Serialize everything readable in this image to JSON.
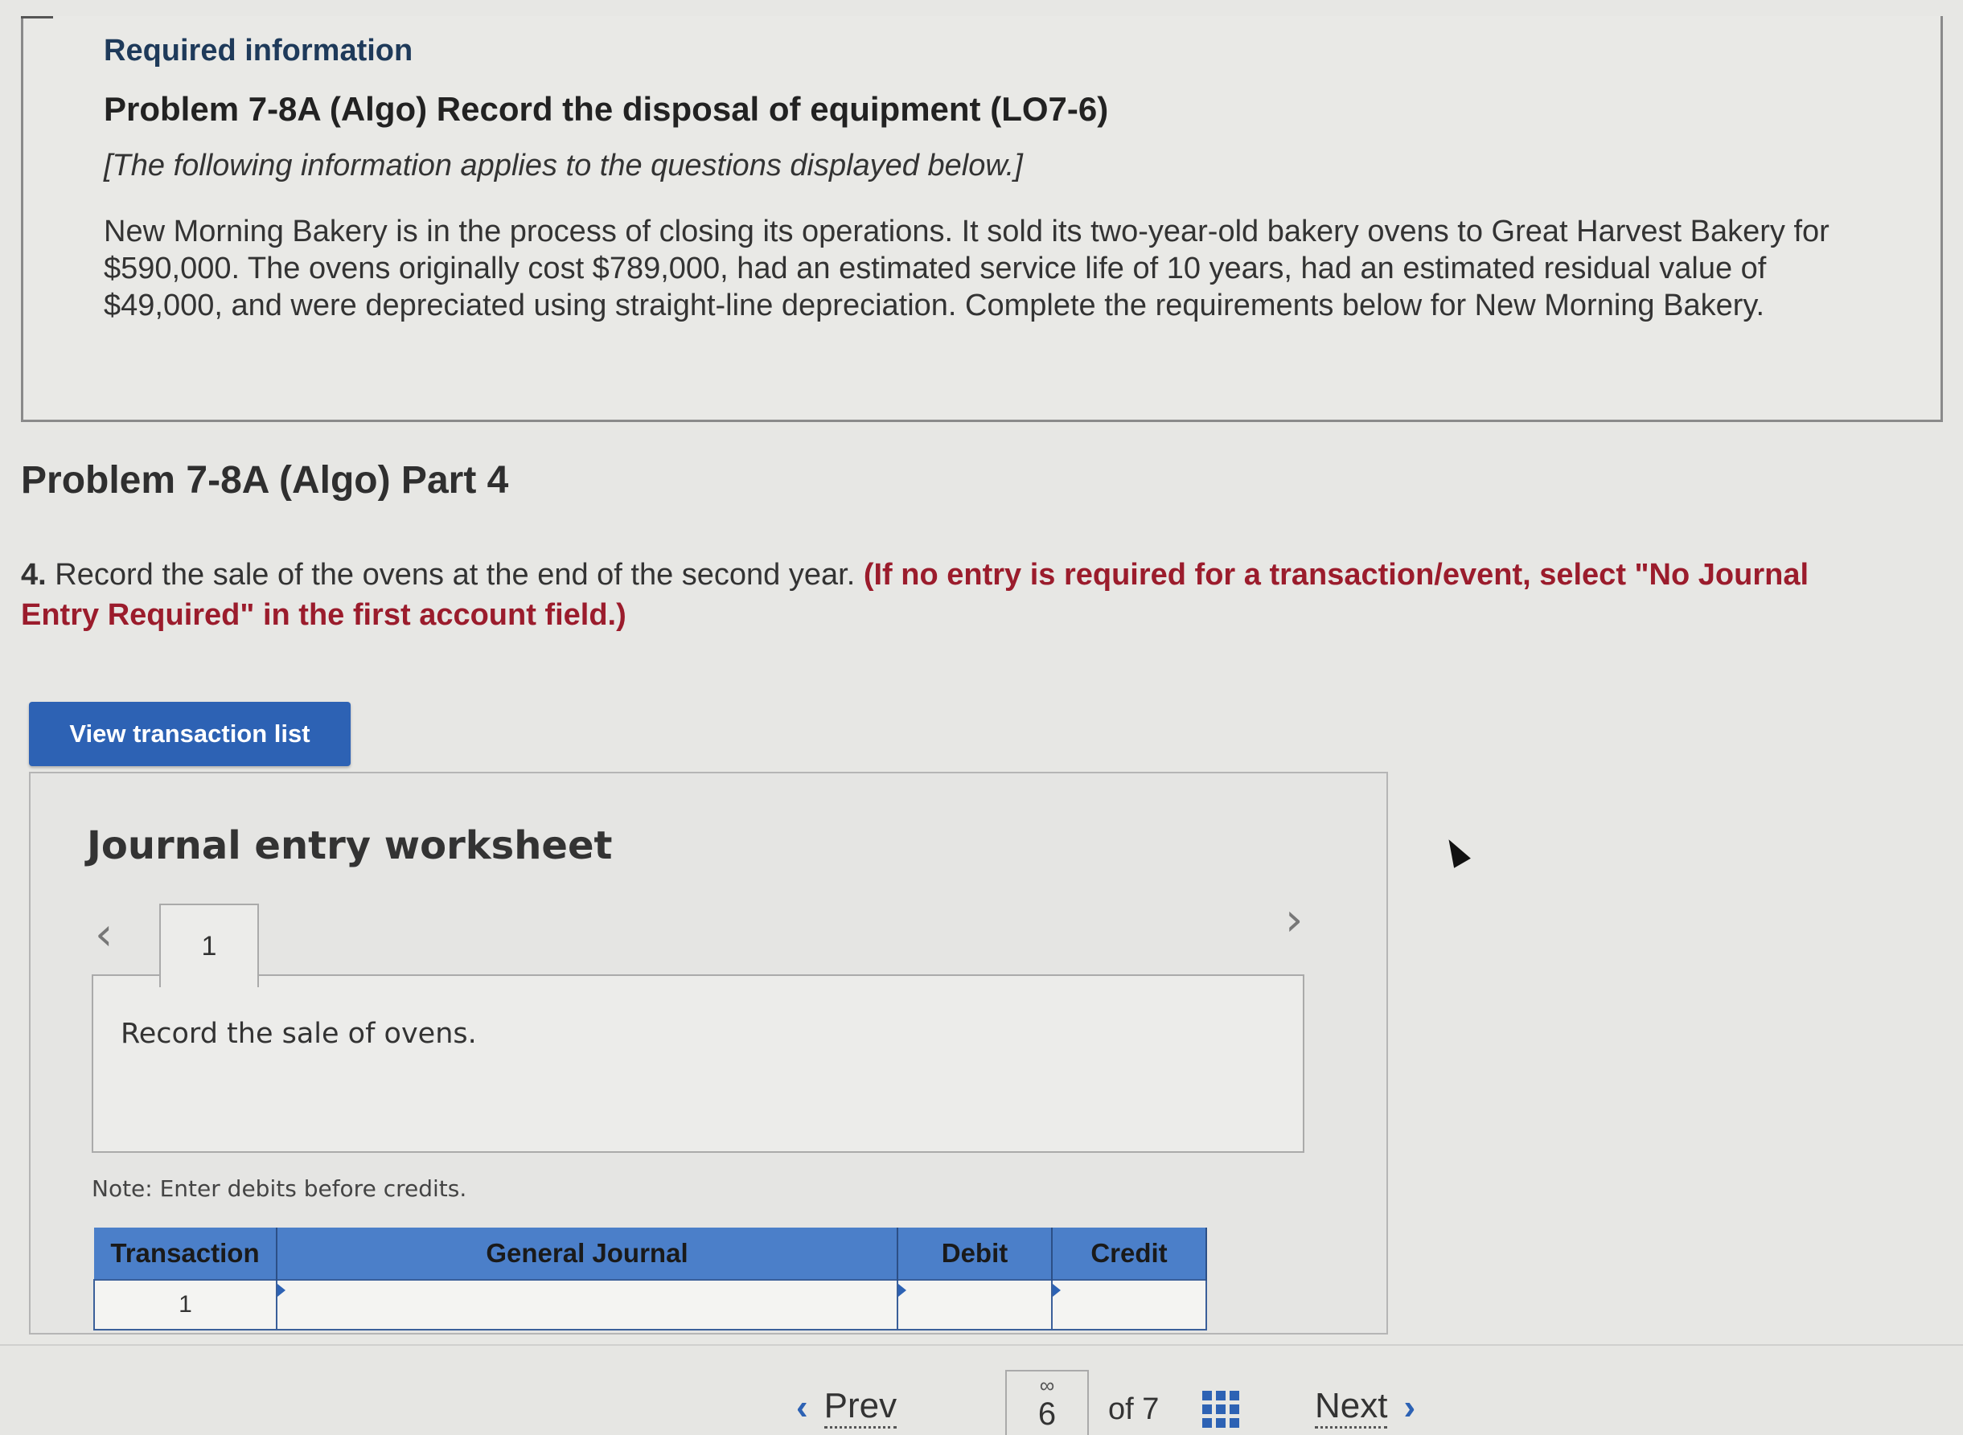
{
  "info": {
    "required_label": "Required information",
    "problem_title": "Problem 7-8A (Algo) Record the disposal of equipment (LO7-6)",
    "applies_note": "[The following information applies to the questions displayed below.]",
    "scenario": "New Morning Bakery is in the process of closing its operations. It sold its two-year-old bakery ovens to Great Harvest Bakery for $590,000. The ovens originally cost $789,000, had an estimated service life of 10 years, had an estimated residual value of $49,000, and were depreciated using straight-line depreciation. Complete the requirements below for New Morning Bakery."
  },
  "part": {
    "heading": "Problem 7-8A (Algo) Part 4",
    "question_number": "4.",
    "question_text": "Record the sale of the ovens at the end of the second year.",
    "instruction": "(If no entry is required for a transaction/event, select \"No Journal Entry Required\" in the first account field.)"
  },
  "buttons": {
    "view_transaction_list": "View transaction list"
  },
  "worksheet": {
    "title": "Journal entry worksheet",
    "tab_label": "1",
    "description": "Record the sale of ovens.",
    "note": "Note: Enter debits before credits.",
    "columns": [
      "Transaction",
      "General Journal",
      "Debit",
      "Credit"
    ],
    "rows": [
      {
        "transaction": "1",
        "general_journal": "",
        "debit": "",
        "credit": ""
      }
    ]
  },
  "footer": {
    "prev_label": "Prev",
    "current_page": "6",
    "of_text": "of 7",
    "next_label": "Next"
  },
  "colors": {
    "accent": "#2d62b4",
    "instruction_red": "#9b1c2c",
    "table_header": "#4b7fc9"
  }
}
